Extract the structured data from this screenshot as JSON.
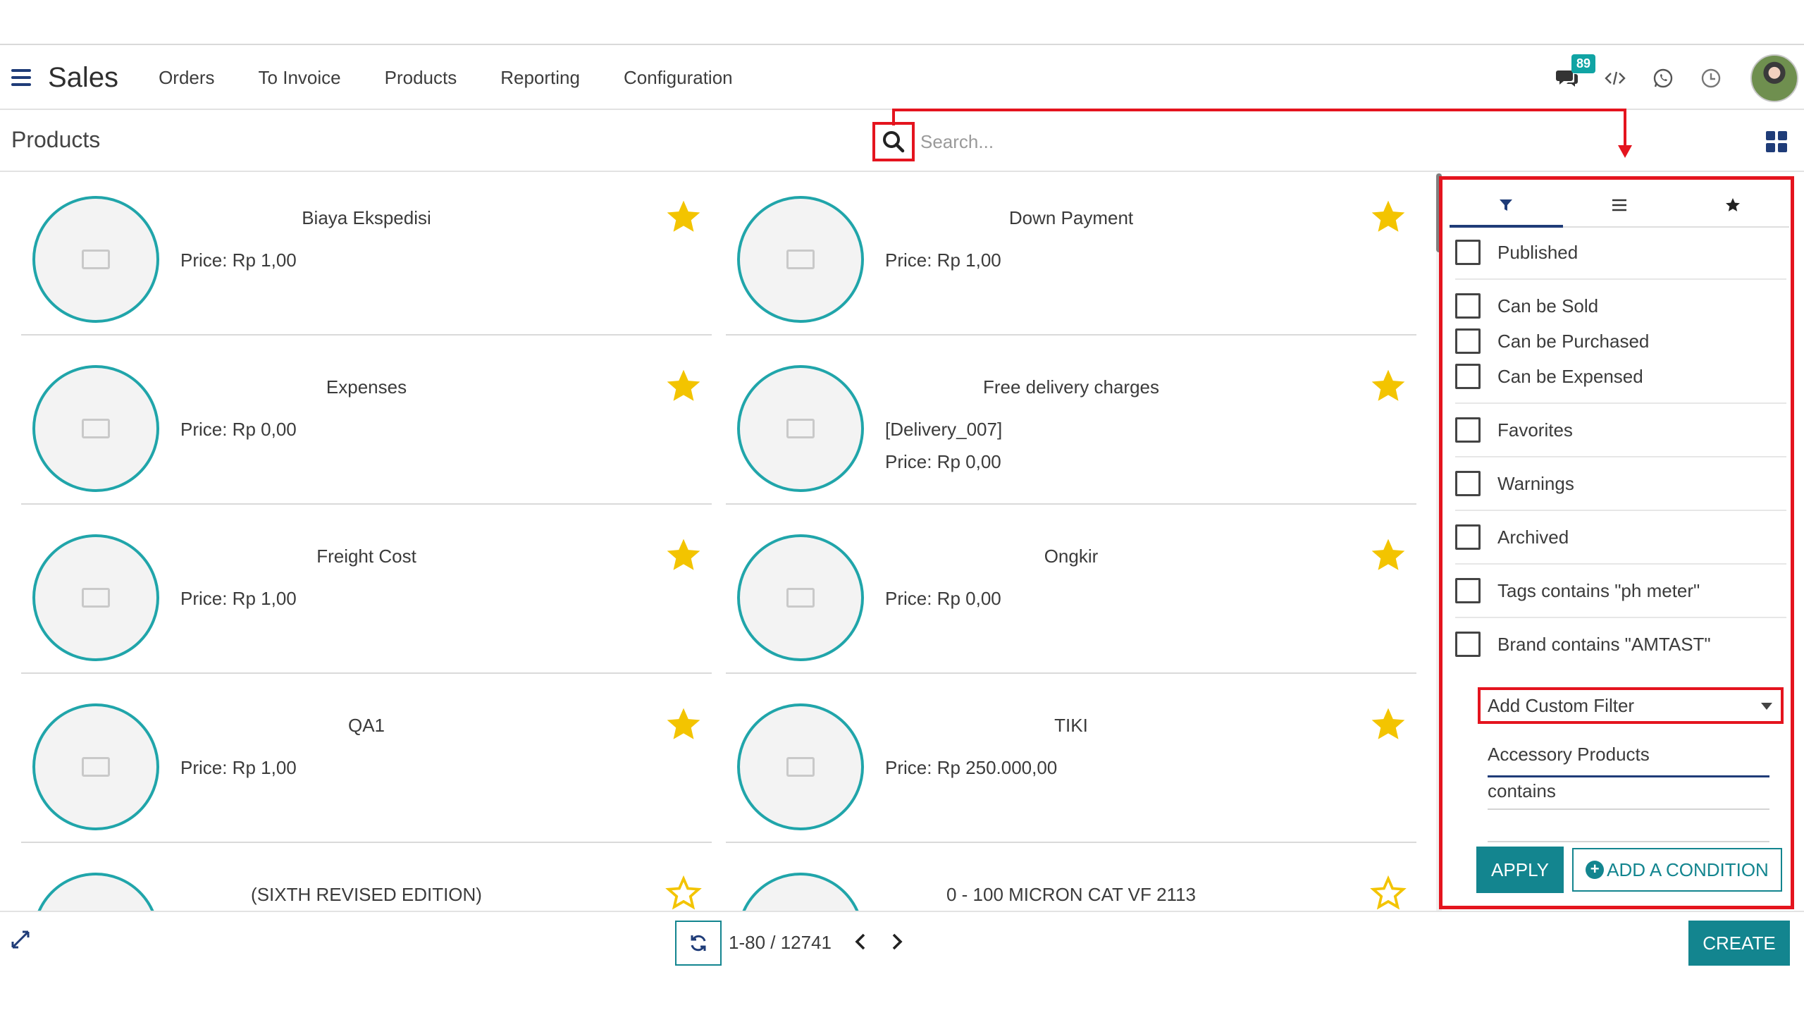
{
  "navbar": {
    "app_title": "Sales",
    "menu": [
      "Orders",
      "To Invoice",
      "Products",
      "Reporting",
      "Configuration"
    ],
    "chat_badge": "89"
  },
  "control": {
    "breadcrumb": "Products",
    "search_placeholder": "Search..."
  },
  "products": [
    {
      "name": "Biaya Ekspedisi",
      "price": "Price: Rp 1,00",
      "favorite": true
    },
    {
      "name": "Down Payment",
      "price": "Price: Rp 1,00",
      "favorite": true
    },
    {
      "name": "Expenses",
      "price": "Price: Rp 0,00",
      "favorite": true
    },
    {
      "name": "Free delivery charges",
      "code": "[Delivery_007]",
      "price": "Price: Rp 0,00",
      "favorite": true
    },
    {
      "name": "Freight Cost",
      "price": "Price: Rp 1,00",
      "favorite": true
    },
    {
      "name": "Ongkir",
      "price": "Price: Rp 0,00",
      "favorite": true
    },
    {
      "name": "QA1",
      "price": "Price: Rp 1,00",
      "favorite": true
    },
    {
      "name": "TIKI",
      "price": "Price: Rp 250.000,00",
      "favorite": true
    },
    {
      "name": "(SIXTH REVISED EDITION)",
      "price": "",
      "favorite": false
    },
    {
      "name": "0 - 100 MICRON CAT VF 2113",
      "price": "",
      "favorite": false
    }
  ],
  "filters": {
    "groups": [
      [
        "Published"
      ],
      [
        "Can be Sold",
        "Can be Purchased",
        "Can be Expensed"
      ],
      [
        "Favorites"
      ],
      [
        "Warnings"
      ],
      [
        "Archived"
      ],
      [
        "Tags contains \"ph meter\""
      ],
      [
        "Brand contains \"AMTAST\""
      ]
    ],
    "custom_filter_label": "Add Custom Filter",
    "condition_field": "Accessory Products",
    "condition_operator": "contains",
    "apply_label": "APPLY",
    "add_condition_label": "ADD A CONDITION"
  },
  "pager": {
    "range": "1-80 / 12741"
  },
  "create_label": "CREATE",
  "colors": {
    "accent": "#13858f",
    "annotation": "#e4141e",
    "star": "#f3c400",
    "nav_blue": "#1f3c78"
  }
}
